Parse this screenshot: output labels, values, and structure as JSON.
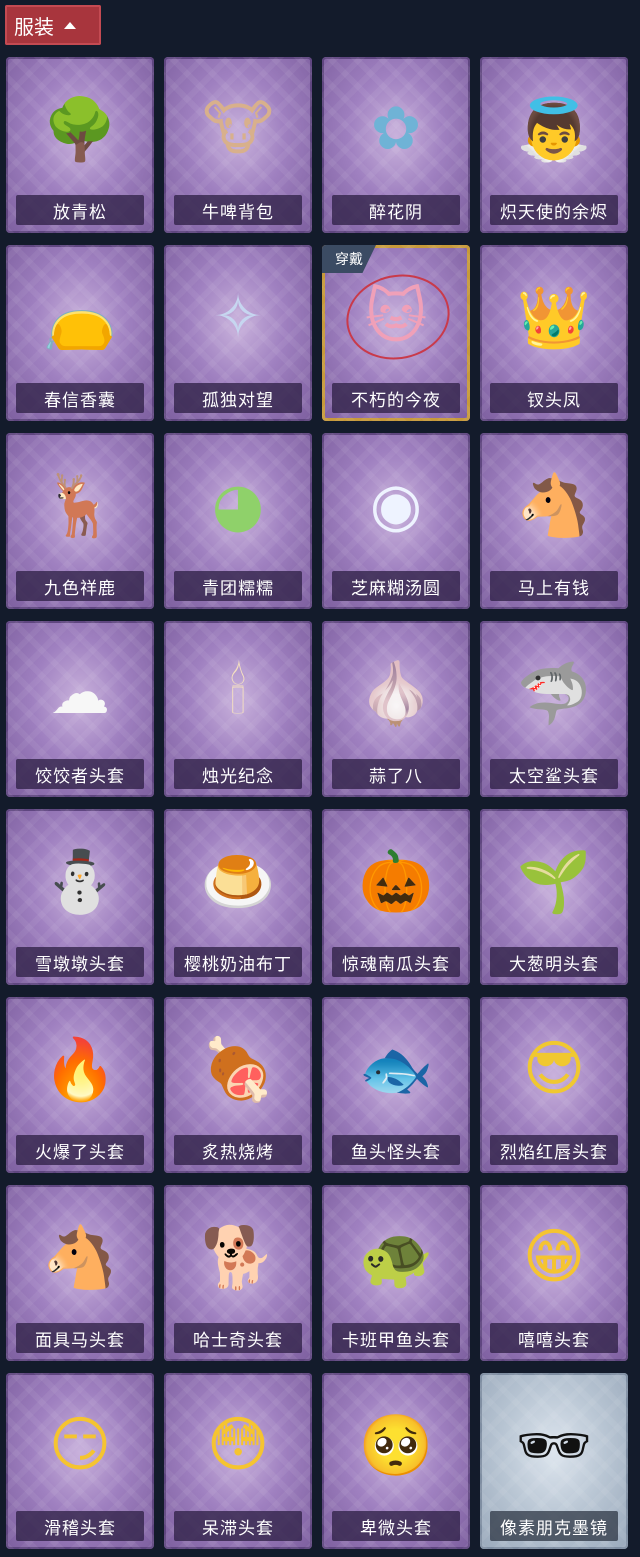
{
  "header": {
    "label": "服装"
  },
  "equipped_badge": "穿戴",
  "items": [
    {
      "name": "放青松",
      "icon": "bonsai-icon",
      "glyph": "🌳",
      "color": "#6aa84f"
    },
    {
      "name": "牛啤背包",
      "icon": "cow-barrel-icon",
      "glyph": "🐮",
      "color": "#d8b08c"
    },
    {
      "name": "醉花阴",
      "icon": "floral-ornament-icon",
      "glyph": "✿",
      "color": "#6fb3d6"
    },
    {
      "name": "炽天使的余烬",
      "icon": "angel-doll-icon",
      "glyph": "👼",
      "color": "#e8d6c8"
    },
    {
      "name": "春信香囊",
      "icon": "sachet-icon",
      "glyph": "👝",
      "color": "#b7e2a8"
    },
    {
      "name": "孤独对望",
      "icon": "figure-charm-icon",
      "glyph": "✧",
      "color": "#c6d6f0"
    },
    {
      "name": "不朽的今夜",
      "icon": "pink-creature-icon",
      "glyph": "🐱",
      "color": "#f0a0b8",
      "equipped": true
    },
    {
      "name": "钗头凤",
      "icon": "crowned-doll-icon",
      "glyph": "👑",
      "color": "#e0b030"
    },
    {
      "name": "九色祥鹿",
      "icon": "deer-icon",
      "glyph": "🦌",
      "color": "#f3f3f3"
    },
    {
      "name": "青团糯糯",
      "icon": "green-mochi-icon",
      "glyph": "◕",
      "color": "#8fd16a"
    },
    {
      "name": "芝麻糊汤圆",
      "icon": "rice-ball-icon",
      "glyph": "◉",
      "color": "#eef3ff"
    },
    {
      "name": "马上有钱",
      "icon": "horse-head-icon",
      "glyph": "🐴",
      "color": "#d03a4a"
    },
    {
      "name": "饺饺者头套",
      "icon": "dumpling-icon",
      "glyph": "☁",
      "color": "#f7f7f7"
    },
    {
      "name": "烛光纪念",
      "icon": "candle-icon",
      "glyph": "🕯",
      "color": "#f5e0c0"
    },
    {
      "name": "蒜了八",
      "icon": "garlic-icon",
      "glyph": "🧄",
      "color": "#f0ecd8"
    },
    {
      "name": "太空鲨头套",
      "icon": "shark-icon",
      "glyph": "🦈",
      "color": "#9ec8ee"
    },
    {
      "name": "雪墩墩头套",
      "icon": "snowman-icon",
      "glyph": "⛄",
      "color": "#ffffff"
    },
    {
      "name": "樱桃奶油布丁",
      "icon": "pudding-icon",
      "glyph": "🍮",
      "color": "#f2c060"
    },
    {
      "name": "惊魂南瓜头套",
      "icon": "pumpkin-icon",
      "glyph": "🎃",
      "color": "#f08a20"
    },
    {
      "name": "大葱明头套",
      "icon": "scallion-icon",
      "glyph": "🌱",
      "color": "#5aa850"
    },
    {
      "name": "火爆了头套",
      "icon": "fire-icon",
      "glyph": "🔥",
      "color": "#f06a20"
    },
    {
      "name": "炙热烧烤",
      "icon": "meat-icon",
      "glyph": "🍖",
      "color": "#d07a3a"
    },
    {
      "name": "鱼头怪头套",
      "icon": "fish-head-icon",
      "glyph": "🐟",
      "color": "#6aa050"
    },
    {
      "name": "烈焰红唇头套",
      "icon": "pikachu-sunglasses-icon",
      "glyph": "😎",
      "color": "#f0c830"
    },
    {
      "name": "面具马头套",
      "icon": "horse-mask-icon",
      "glyph": "🐴",
      "color": "#7a3a20"
    },
    {
      "name": "哈士奇头套",
      "icon": "husky-icon",
      "glyph": "🐕",
      "color": "#a87a50"
    },
    {
      "name": "卡班甲鱼头套",
      "icon": "turtle-icon",
      "glyph": "🐢",
      "color": "#6a7688"
    },
    {
      "name": "嘻嘻头套",
      "icon": "grin-emoji-icon",
      "glyph": "😁",
      "color": "#f5c430"
    },
    {
      "name": "滑稽头套",
      "icon": "silly-emoji-icon",
      "glyph": "😏",
      "color": "#f5c430"
    },
    {
      "name": "呆滞头套",
      "icon": "dazed-emoji-icon",
      "glyph": "😳",
      "color": "#f5c430"
    },
    {
      "name": "卑微头套",
      "icon": "shy-emoji-icon",
      "glyph": "🥺",
      "color": "#f5c430"
    },
    {
      "name": "像素朋克墨镜",
      "icon": "pixel-sunglasses-icon",
      "glyph": "🕶",
      "color": "#111111",
      "special": true
    }
  ]
}
